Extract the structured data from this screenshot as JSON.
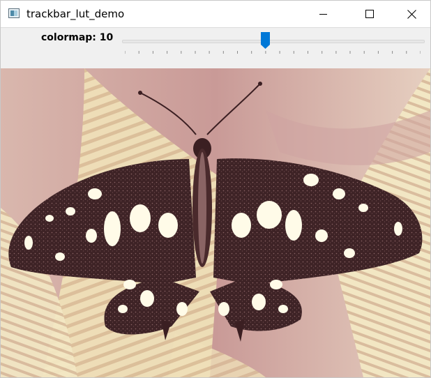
{
  "window": {
    "title": "trackbar_lut_demo",
    "icon": "image-window-icon",
    "controls": [
      "minimize-icon",
      "maximize-icon",
      "close-icon"
    ]
  },
  "trackbar": {
    "label": "colormap: 10",
    "name": "colormap",
    "value": 10,
    "max": 21,
    "accent_color": "#0078d7"
  },
  "image": {
    "description_icon": "butterfly-photo",
    "palette": [
      "#f4e9c6",
      "#e6c7b8",
      "#c08a8a",
      "#3b1f22",
      "#fffbe8"
    ]
  }
}
